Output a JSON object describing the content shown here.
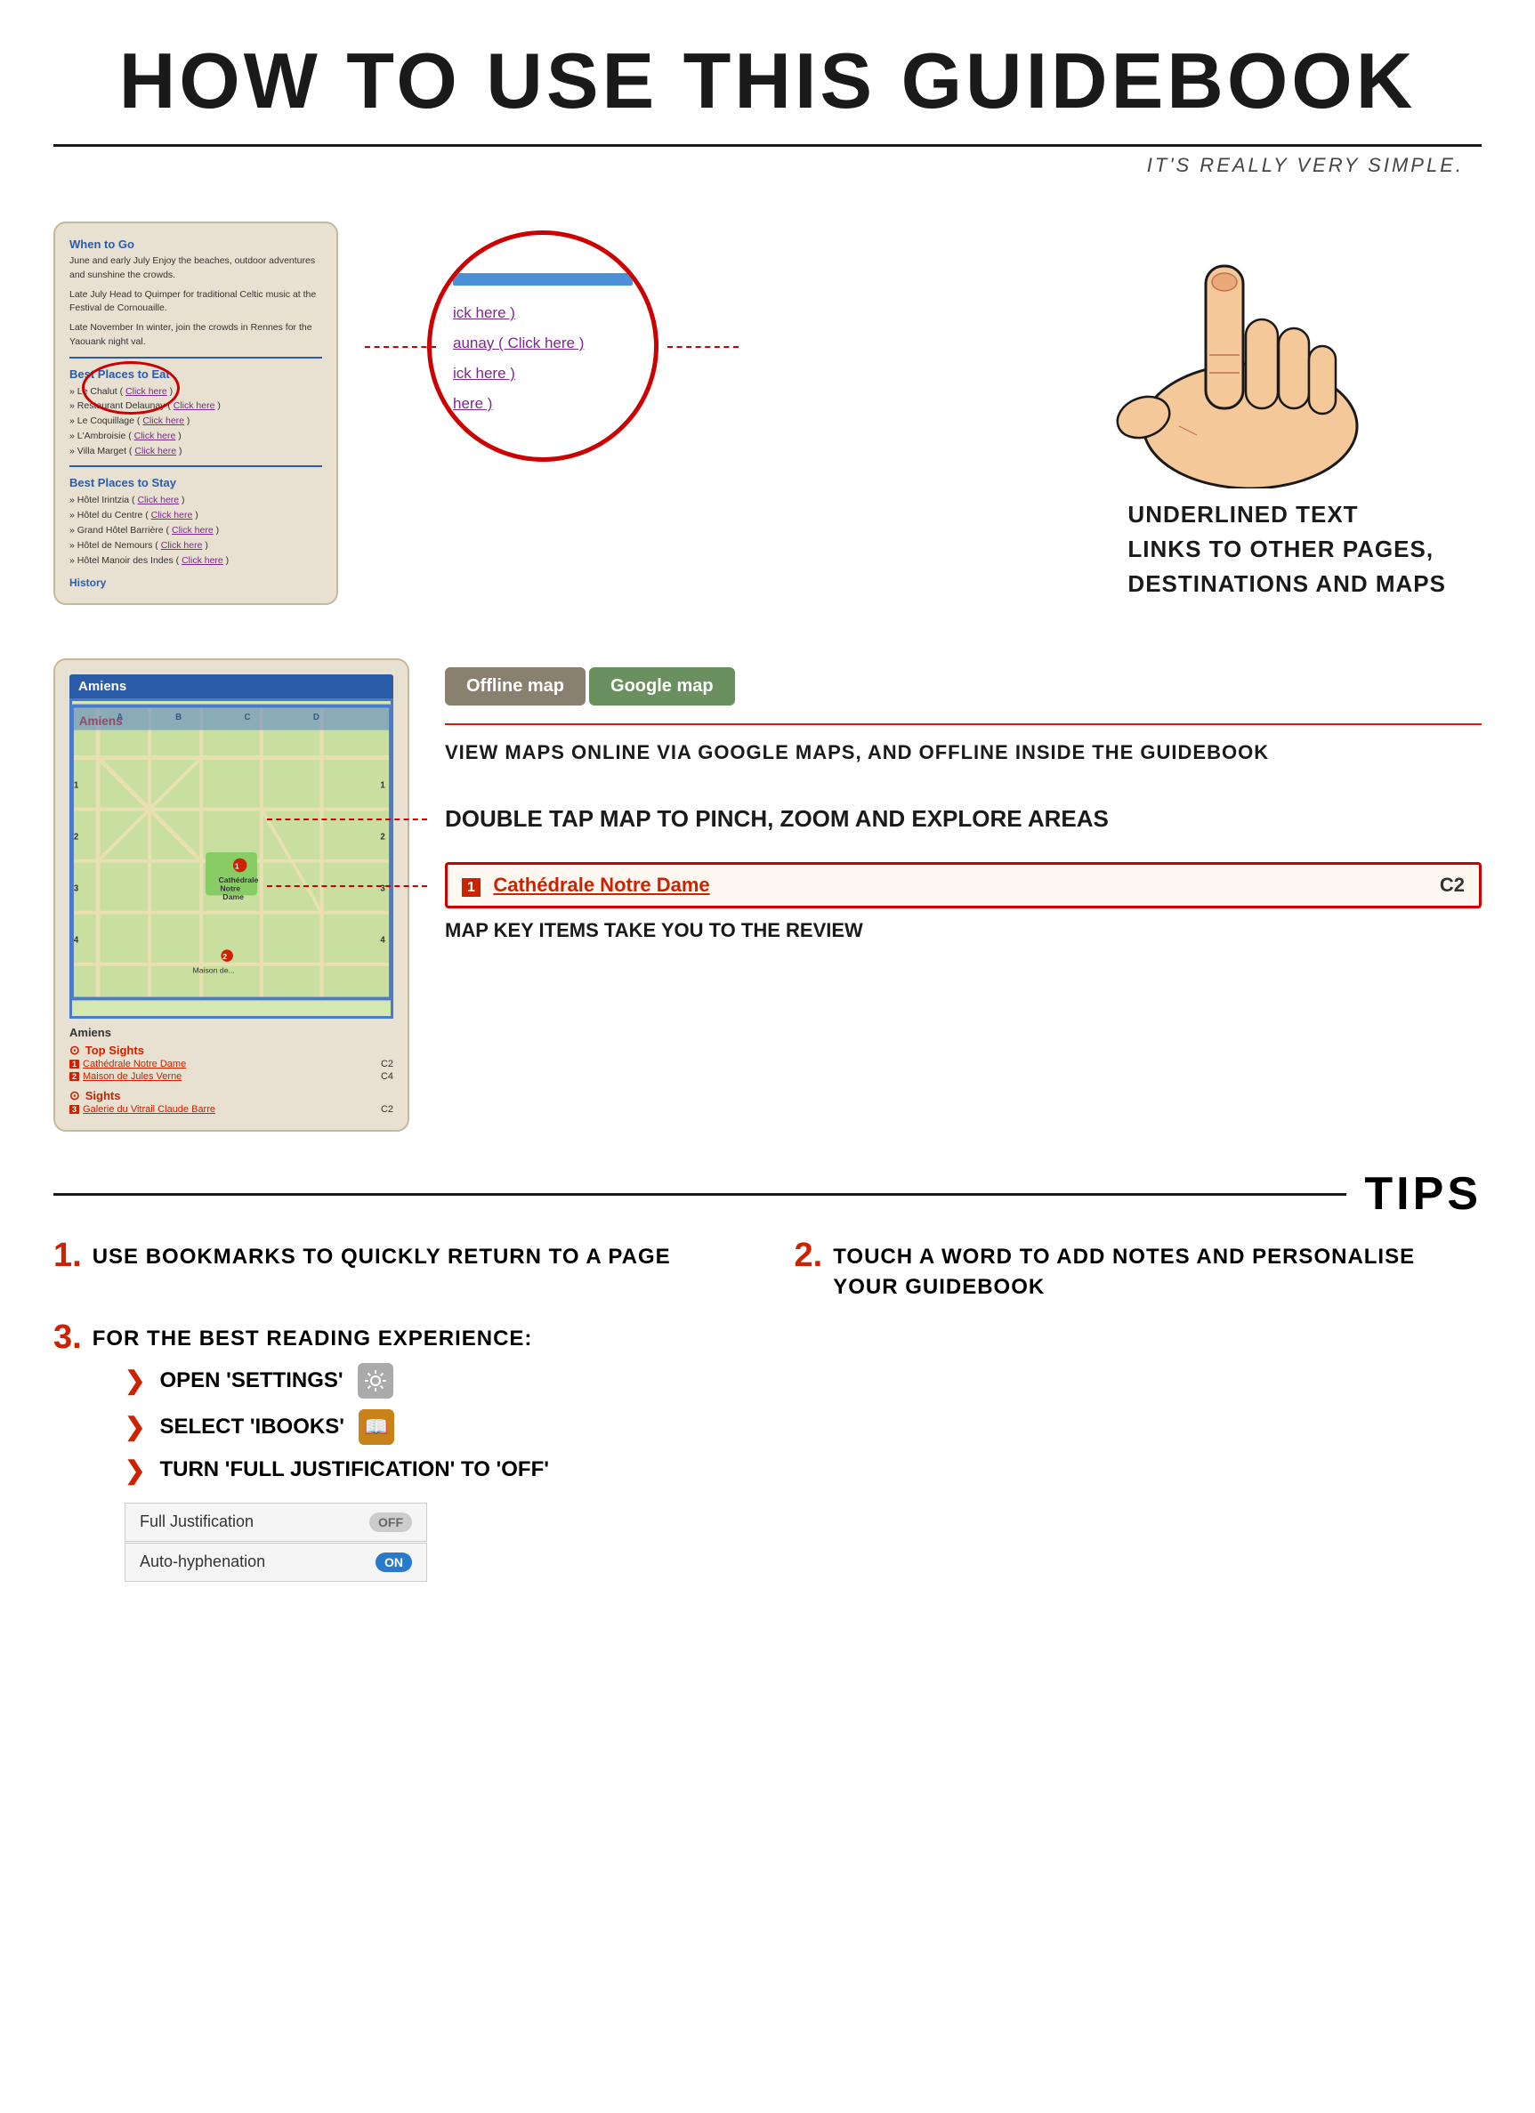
{
  "header": {
    "title": "HOW TO USE THIS GUIDEBOOK",
    "subtitle": "IT'S REALLY VERY SIMPLE."
  },
  "section1": {
    "phone": {
      "when_to_go_title": "When to Go",
      "when_to_go_text1": "June and early July Enjoy the beaches, outdoor adventures and sunshine the crowds.",
      "when_to_go_text2": "Late July Head to Quimper for traditional Celtic music at the Festival de Cornouaille.",
      "when_to_go_text3": "Late November In winter, join the crowds in Rennes for the Yaouank night val.",
      "best_eat_title": "Best Places to Eat",
      "best_eat_items": [
        "Le Chalut ( Click here )",
        "Restaurant Delaunay ( Click here )",
        "Le Coquillage ( Click here )",
        "L'Ambroisie ( Click here )",
        "Villa Marget ( Click here )"
      ],
      "best_stay_title": "Best Places to Stay",
      "best_stay_items": [
        "Hôtel Irintzia ( Click here )",
        "Hôtel du Centre ( Click here )",
        "Grand Hôtel Barrière ( Click here )",
        "Hôtel de Nemours ( Click here )",
        "Hôtel Manoir des Indes ( Click here )"
      ],
      "history": "History"
    },
    "zoomed": {
      "items": [
        "ick here )",
        "aunay ( Click here )",
        "ick here )",
        "here )"
      ]
    },
    "description": {
      "line1": "UNDERLINED TEXT",
      "line2": "LINKS TO OTHER PAGES,",
      "line3": "DESTINATIONS AND MAPS"
    }
  },
  "section2": {
    "map_title": "Amiens",
    "offline_btn": "Offline map",
    "google_btn": "Google map",
    "view_maps_text": "VIEW MAPS ONLINE VIA GOOGLE MAPS, AND OFFLINE INSIDE THE GUIDEBOOK",
    "zoom_text": "DOUBLE TAP MAP TO PINCH, ZOOM AND EXPLORE AREAS",
    "map_key_name": "Cathédrale Notre Dame",
    "map_key_coord": "C2",
    "map_key_num": "1",
    "map_key_desc": "MAP KEY ITEMS TAKE YOU TO THE REVIEW",
    "top_sights": "Top Sights",
    "sights": "Sights",
    "key_items": [
      {
        "num": "1",
        "name": "Cathédrale Notre Dame",
        "coord": "C2"
      },
      {
        "num": "2",
        "name": "Maison de Jules Verne",
        "coord": "C4"
      }
    ],
    "sight_items": [
      {
        "num": "3",
        "name": "Galerie du Vitrail Claude Barre",
        "coord": "C2"
      }
    ]
  },
  "tips": {
    "label": "TIPS",
    "items": [
      {
        "number": "1.",
        "text": "USE BOOKMARKS TO QUICKLY RETURN TO A PAGE"
      },
      {
        "number": "2.",
        "text": "TOUCH A WORD TO ADD NOTES AND PERSONALISE YOUR GUIDEBOOK"
      }
    ],
    "tip3": {
      "number": "3.",
      "text": "FOR THE BEST READING EXPERIENCE:",
      "sub_items": [
        {
          "text": "Open 'Settings'",
          "icon": "⚙"
        },
        {
          "text": "Select 'iBooks'",
          "icon": "📖"
        },
        {
          "text": "Turn 'Full Justification' to 'off'",
          "icon": ""
        }
      ]
    },
    "settings": [
      {
        "label": "Full Justification",
        "toggle": "OFF",
        "type": "off"
      },
      {
        "label": "Auto-hyphenation",
        "toggle": "ON",
        "type": "on"
      }
    ]
  }
}
